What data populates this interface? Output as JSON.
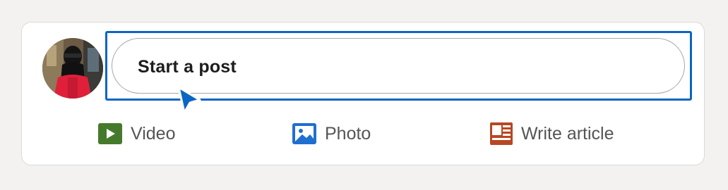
{
  "composer": {
    "placeholder": "Start a post",
    "avatar_alt": "avatar"
  },
  "actions": [
    {
      "label": "Video",
      "icon": "video-icon",
      "color": "#457a2c"
    },
    {
      "label": "Photo",
      "icon": "photo-icon",
      "color": "#1f6fd1"
    },
    {
      "label": "Write article",
      "icon": "article-icon",
      "color": "#b64823"
    }
  ],
  "colors": {
    "focus": "#0a66c2",
    "background": "#f3f2f0",
    "cursor": "#0a66c2"
  }
}
